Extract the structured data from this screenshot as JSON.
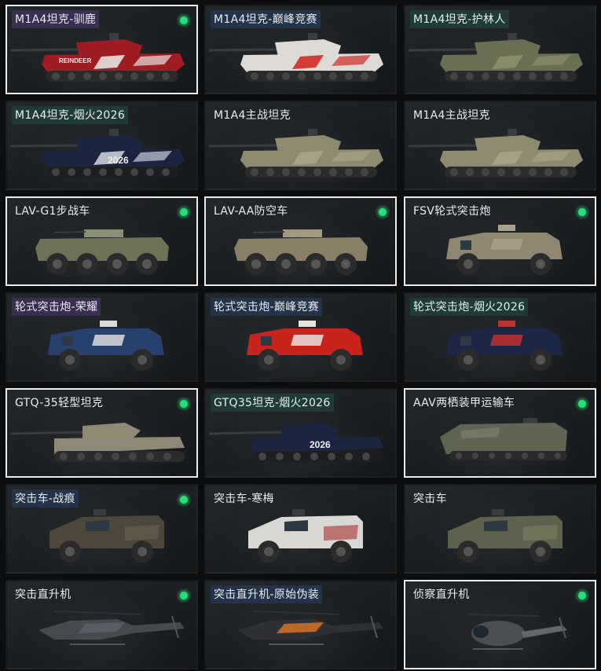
{
  "vehicles": [
    {
      "name": "M1A4坦克-驯鹿",
      "kind": "tank",
      "tag": "purple",
      "badge": true,
      "selected": true,
      "body": "#9e1c22",
      "accent": "#e7e2de",
      "track": "#2a2a2a",
      "decal": "REINDEER"
    },
    {
      "name": "M1A4坦克-巅峰竞赛",
      "kind": "tank",
      "tag": "blue",
      "badge": false,
      "selected": false,
      "body": "#dedad6",
      "accent": "#d22b25",
      "track": "#2a2a2a",
      "decal": ""
    },
    {
      "name": "M1A4坦克-护林人",
      "kind": "tank",
      "tag": "green",
      "badge": false,
      "selected": false,
      "body": "#6a6e52",
      "accent": "#8c8f6e",
      "track": "#2a2a2a",
      "decal": ""
    },
    {
      "name": "M1A4坦克-烟火2026",
      "kind": "tank",
      "tag": "green",
      "badge": false,
      "selected": false,
      "body": "#1b2540",
      "accent": "#c8ccd6",
      "track": "#1e1e22",
      "decal": "2026"
    },
    {
      "name": "M1A4主战坦克",
      "kind": "tank",
      "tag": "",
      "badge": false,
      "selected": false,
      "body": "#8d8a70",
      "accent": "#a7a488",
      "track": "#2c2c2a",
      "decal": ""
    },
    {
      "name": "M1A4主战坦克",
      "kind": "tank",
      "tag": "",
      "badge": false,
      "selected": false,
      "body": "#8d8a70",
      "accent": "#a7a488",
      "track": "#2c2c2a",
      "decal": ""
    },
    {
      "name": "LAV-G1步战车",
      "kind": "apc",
      "tag": "",
      "badge": true,
      "selected": true,
      "body": "#6d7257",
      "accent": "#8b8f74",
      "track": "#2a2a2a",
      "decal": ""
    },
    {
      "name": "LAV-AA防空车",
      "kind": "apc",
      "tag": "",
      "badge": true,
      "selected": true,
      "body": "#8a7e66",
      "accent": "#a39880",
      "track": "#2a2a2a",
      "decal": ""
    },
    {
      "name": "FSV轮式突击炮",
      "kind": "armoredcar",
      "tag": "",
      "badge": true,
      "selected": true,
      "body": "#8f8671",
      "accent": "#a8a08b",
      "track": "#2a2a2a",
      "decal": ""
    },
    {
      "name": "轮式突击炮-荣耀",
      "kind": "armoredcar",
      "tag": "purple",
      "badge": false,
      "selected": false,
      "body": "#28406e",
      "accent": "#d8dade",
      "track": "#2a2a2a",
      "decal": ""
    },
    {
      "name": "轮式突击炮-巅峰竞赛",
      "kind": "armoredcar",
      "tag": "blue",
      "badge": false,
      "selected": false,
      "body": "#c9231d",
      "accent": "#e6e2dd",
      "track": "#2a2a2a",
      "decal": ""
    },
    {
      "name": "轮式突击炮-烟火2026",
      "kind": "armoredcar",
      "tag": "green",
      "badge": false,
      "selected": false,
      "body": "#1c2746",
      "accent": "#c03030",
      "track": "#2a2a2a",
      "decal": ""
    },
    {
      "name": "GTQ-35轻型坦克",
      "kind": "lighttank",
      "tag": "",
      "badge": true,
      "selected": true,
      "body": "#8e8875",
      "accent": "#a9a38f",
      "track": "#2b2b2b",
      "decal": ""
    },
    {
      "name": "GTQ35坦克-烟火2026",
      "kind": "lighttank",
      "tag": "green",
      "badge": false,
      "selected": false,
      "body": "#1b2540",
      "accent": "#c8ccd6",
      "track": "#1e1e22",
      "decal": "2026"
    },
    {
      "name": "AAV两栖装甲运输车",
      "kind": "amphib",
      "tag": "",
      "badge": true,
      "selected": true,
      "body": "#5f6550",
      "accent": "#7b806a",
      "track": "#2a2a2a",
      "decal": ""
    },
    {
      "name": "突击车-战痕",
      "kind": "mrap",
      "tag": "blue",
      "badge": true,
      "selected": false,
      "body": "#4d463a",
      "accent": "#6b6252",
      "track": "#2a2a2a",
      "decal": ""
    },
    {
      "name": "突击车-寒梅",
      "kind": "mrap",
      "tag": "",
      "badge": false,
      "selected": false,
      "body": "#d9d8d4",
      "accent": "#a23030",
      "track": "#2a2a2a",
      "decal": ""
    },
    {
      "name": "突击车",
      "kind": "mrap",
      "tag": "",
      "badge": false,
      "selected": false,
      "body": "#5e624d",
      "accent": "#7a7e68",
      "track": "#2a2a2a",
      "decal": ""
    },
    {
      "name": "突击直升机",
      "kind": "heli",
      "tag": "",
      "badge": true,
      "selected": false,
      "body": "#454a4f",
      "accent": "#5b6166",
      "track": "#2a2a2a",
      "decal": ""
    },
    {
      "name": "突击直升机-原始伪装",
      "kind": "heli",
      "tag": "blue",
      "badge": false,
      "selected": false,
      "body": "#2e3034",
      "accent": "#e0762a",
      "track": "#2a2a2a",
      "decal": ""
    },
    {
      "name": "侦察直升机",
      "kind": "scout",
      "tag": "",
      "badge": true,
      "selected": true,
      "body": "#4a4f53",
      "accent": "#62676b",
      "track": "#2a2a2a",
      "decal": ""
    }
  ]
}
